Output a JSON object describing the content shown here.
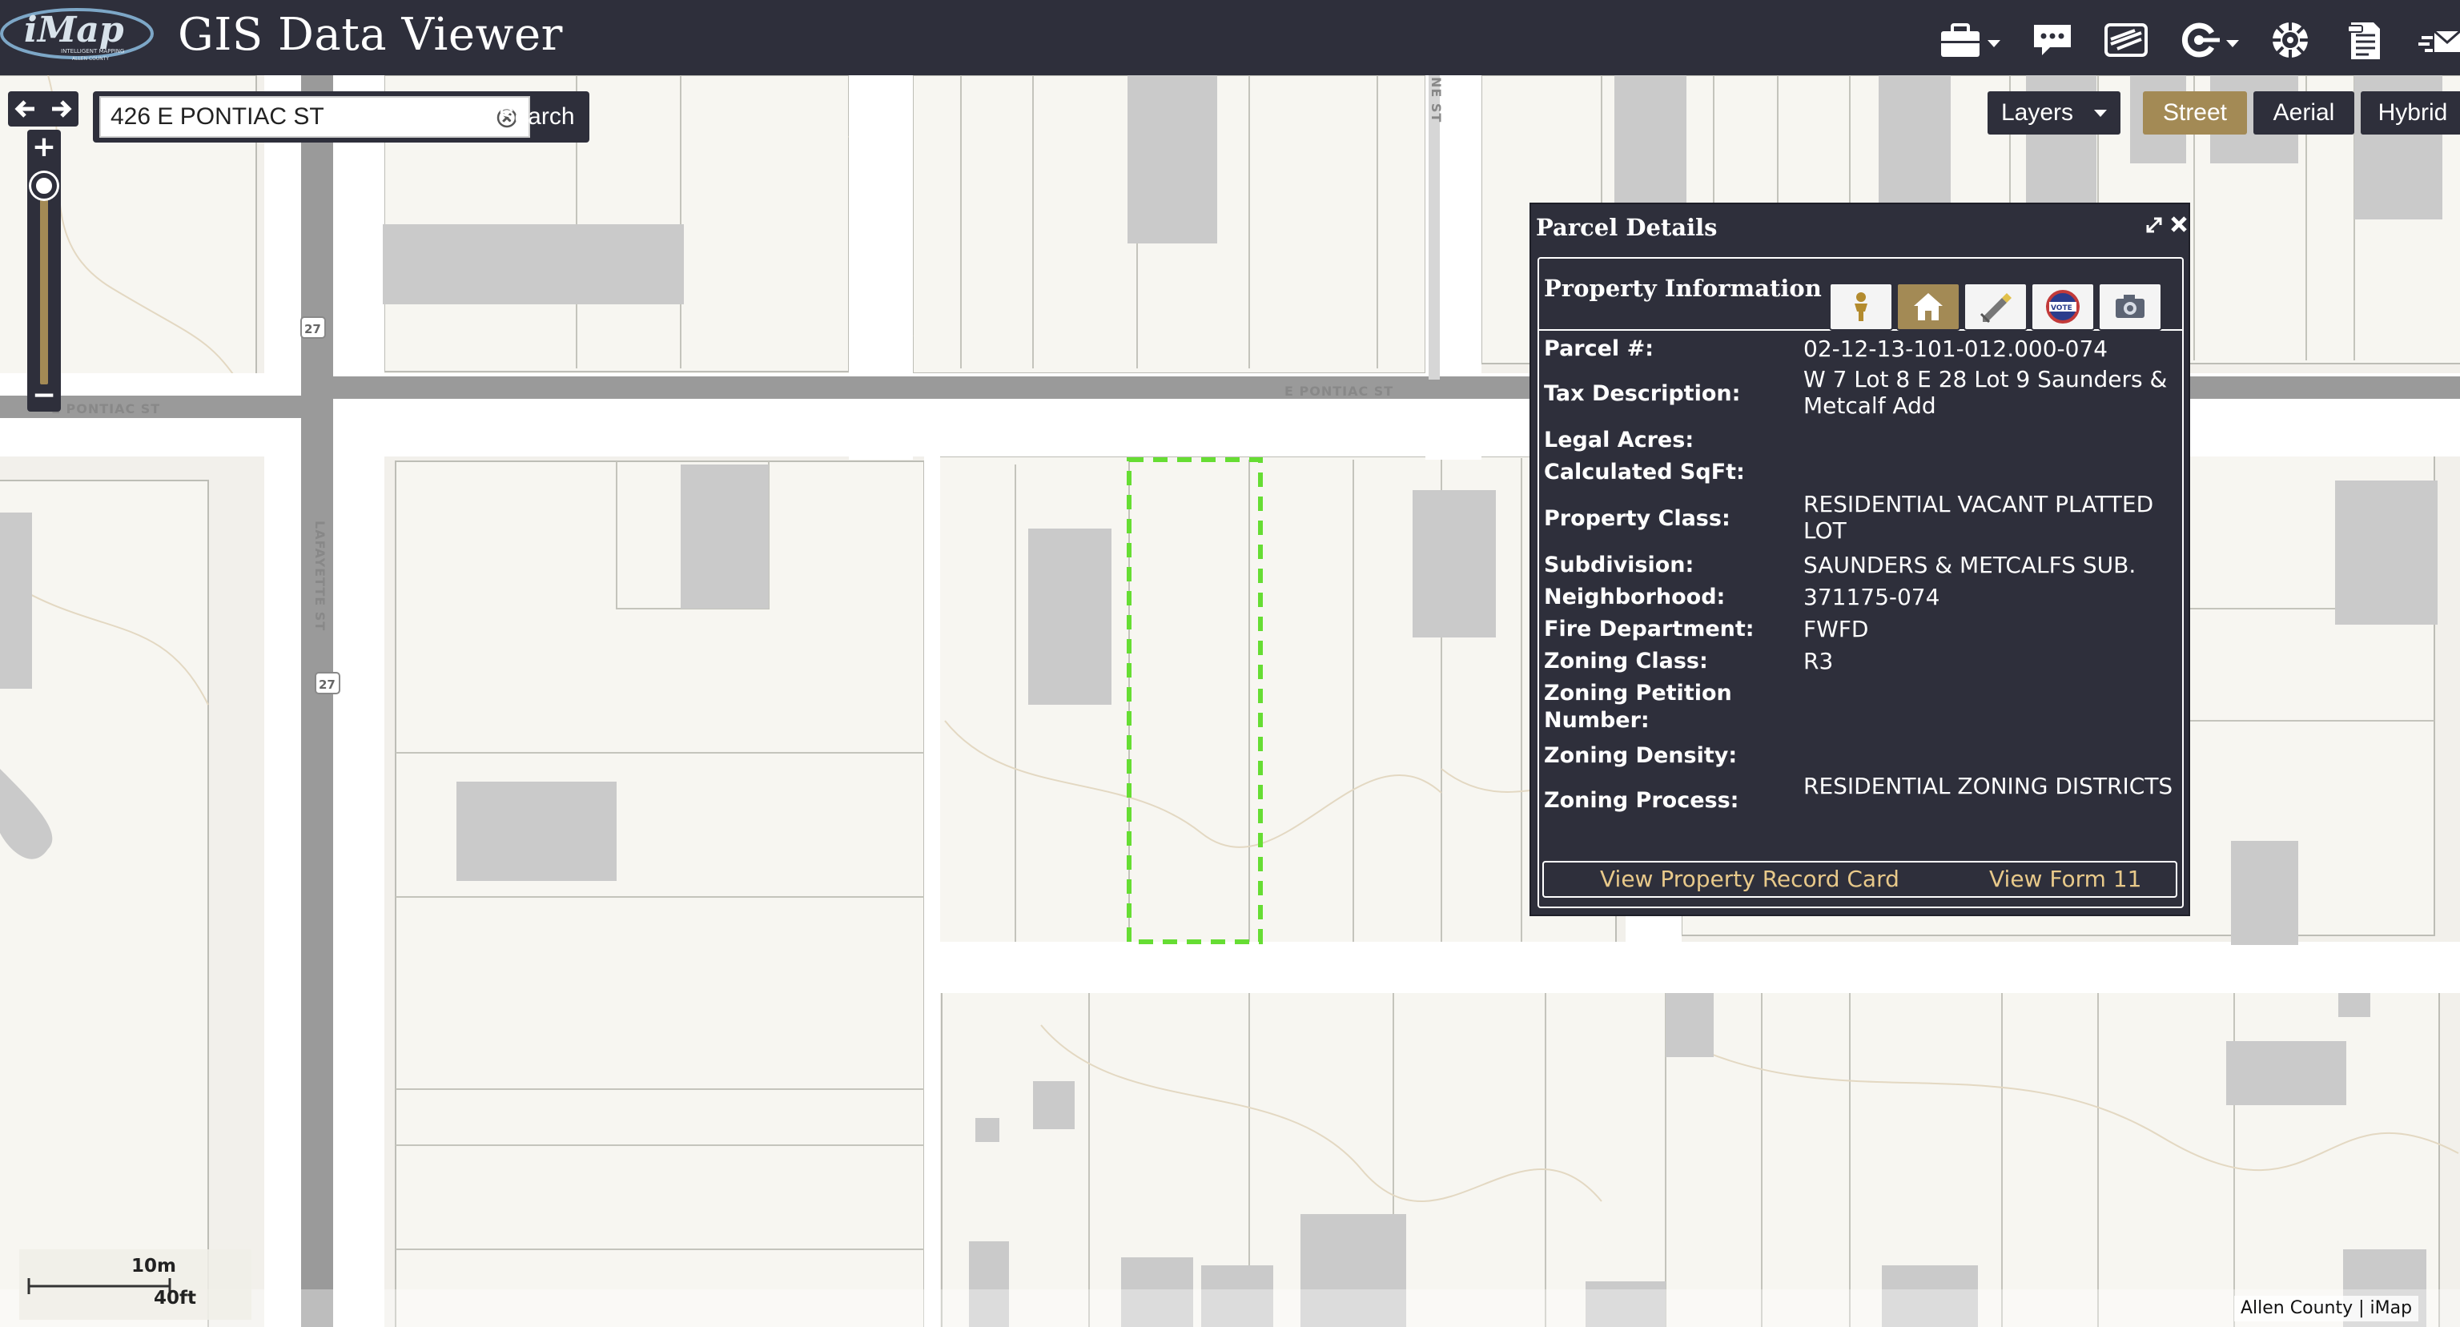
{
  "app": {
    "title": "GIS Data Viewer",
    "logo_text": "iMap",
    "logo_subtext": "INTELLIGENT MAPPING",
    "logo_county": "ALLEN COUNTY"
  },
  "header_icons": [
    "toolbox-icon",
    "speech-bubble-icon",
    "layers-stack-icon",
    "tools-icon",
    "settings-gear-icon",
    "clipboard-icon",
    "mail-icon"
  ],
  "search": {
    "value": "426 E PONTIAC ST",
    "button_label": "Search"
  },
  "basemap": {
    "layers_label": "Layers",
    "options": [
      "Street",
      "Aerial",
      "Hybrid"
    ],
    "active": "Street"
  },
  "map_labels": {
    "pontiac_east": "E PONTIAC ST",
    "pontiac_west": "E PONTIAC ST",
    "lafayette": "LAFAYETTE ST",
    "route_1": "27",
    "route_2": "27",
    "cross_street": "NE ST"
  },
  "panel": {
    "title": "Parcel Details",
    "section_title": "Property Information",
    "tab_icons": [
      "person-icon",
      "house-icon",
      "pen-icon",
      "vote-icon",
      "camera-icon"
    ],
    "active_tab": "house-icon",
    "rows": [
      {
        "label": "Parcel #:",
        "value": "02-12-13-101-012.000-074"
      },
      {
        "label": "Tax Description:",
        "value": "W 7 Lot 8 E 28 Lot 9 Saunders & Metcalf Add"
      },
      {
        "label": "Legal Acres:",
        "value": ""
      },
      {
        "label": "Calculated SqFt:",
        "value": ""
      },
      {
        "label": "Property Class:",
        "value": "RESIDENTIAL VACANT PLATTED LOT"
      },
      {
        "label": "Subdivision:",
        "value": "SAUNDERS & METCALFS SUB."
      },
      {
        "label": "Neighborhood:",
        "value": "371175-074"
      },
      {
        "label": "Fire Department:",
        "value": "FWFD"
      },
      {
        "label": "Zoning Class:",
        "value": "R3"
      },
      {
        "label": "Zoning Petition Number:",
        "value": ""
      },
      {
        "label": "Zoning Density:",
        "value": ""
      },
      {
        "label": "Zoning Process:",
        "value": "RESIDENTIAL ZONING DISTRICTS"
      }
    ],
    "links": {
      "record_card": "View Property Record Card",
      "form_11": "View Form 11"
    }
  },
  "scale": {
    "metric": "10m",
    "imperial": "40ft"
  },
  "attribution": "Allen County | iMap",
  "colors": {
    "header_bg": "#2e2f3b",
    "accent": "#a38a55",
    "link": "#e8c98a",
    "selected_parcel": "#66dd33"
  }
}
